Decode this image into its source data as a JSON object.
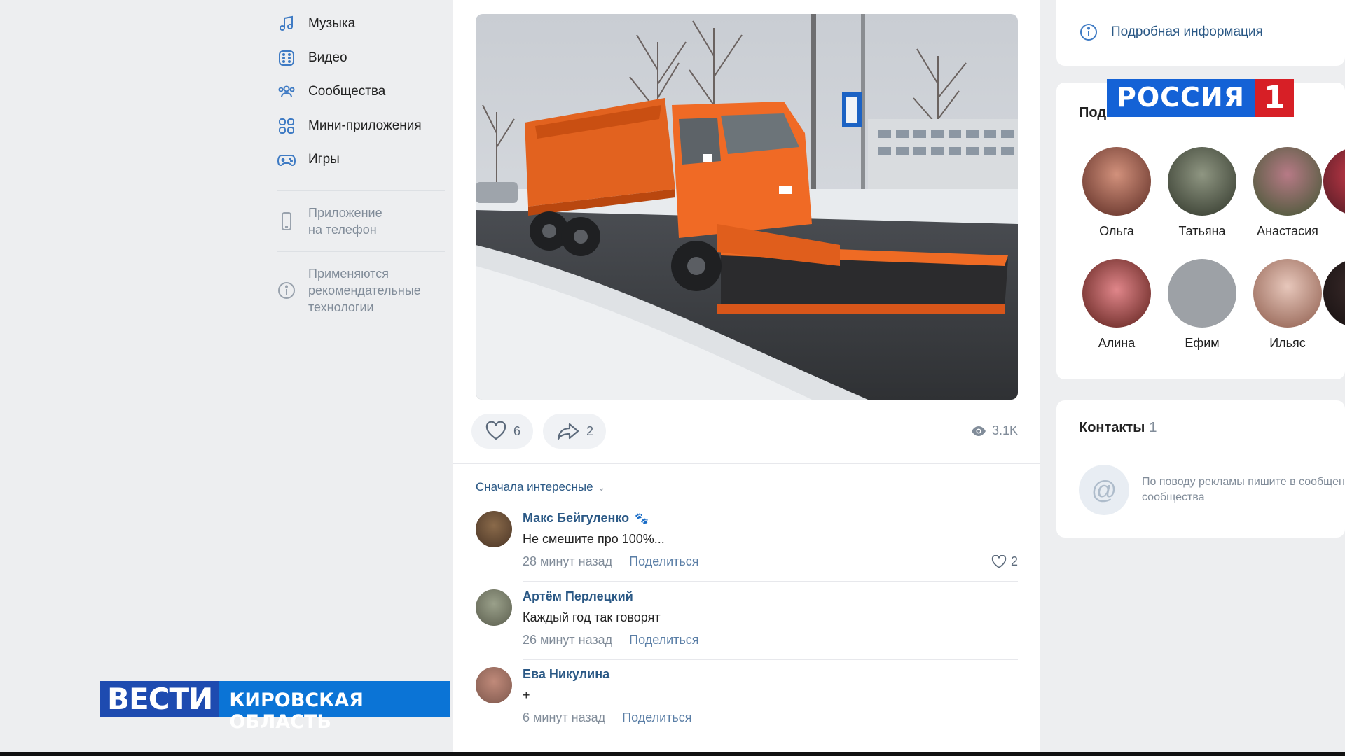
{
  "nav": {
    "items": [
      {
        "label": "Музыка",
        "icon": "music-icon"
      },
      {
        "label": "Видео",
        "icon": "video-icon"
      },
      {
        "label": "Сообщества",
        "icon": "communities-icon"
      },
      {
        "label": "Мини-приложения",
        "icon": "apps-icon"
      },
      {
        "label": "Игры",
        "icon": "gamepad-icon"
      }
    ],
    "phone_app": {
      "line1": "Приложение",
      "line2": "на телефон"
    },
    "recommend": {
      "line1": "Применяются",
      "line2": "рекомендательные",
      "line3": "технологии"
    }
  },
  "post": {
    "image_alt": "Оранжевая снегоуборочная машина КАМАЗ на заснеженной дороге",
    "likes": "6",
    "shares": "2",
    "views": "3.1K",
    "sort_label": "Сначала интересные"
  },
  "comments": [
    {
      "author": "Макс Бейгуленко",
      "text": "Не смешите про 100%...",
      "time": "28 минут назад",
      "share": "Поделиться",
      "likes": "2"
    },
    {
      "author": "Артём Перлецкий",
      "text": "Каждый год так говорят",
      "time": "26 минут назад",
      "share": "Поделиться"
    },
    {
      "author": "Ева Никулина",
      "text": "+",
      "time": "6 минут назад",
      "share": "Поделиться"
    }
  ],
  "sidebar": {
    "info_link": "Подробная информация",
    "subscribers_title": "Подписчики",
    "subscribers": [
      {
        "name": "Ольга",
        "color": "#7a3b2e"
      },
      {
        "name": "Татьяна",
        "color": "#4a5540"
      },
      {
        "name": "Анастасия",
        "color": "#6b4e3a"
      },
      {
        "name": "Алина",
        "color": "#8a3a2a"
      },
      {
        "name": "Ефим",
        "color": "#9da1a6"
      },
      {
        "name": "Ильяс",
        "color": "#b79a8c"
      }
    ],
    "contacts_title": "Контакты",
    "contacts_count": "1",
    "contacts_text_1": "По поводу рекламы пишите в сообщения",
    "contacts_text_2": "сообщества"
  },
  "overlay": {
    "channel": "РОССИЯ",
    "channel_number": "1",
    "program": "ВЕСТИ",
    "region": "КИРОВСКАЯ ОБЛАСТЬ"
  }
}
